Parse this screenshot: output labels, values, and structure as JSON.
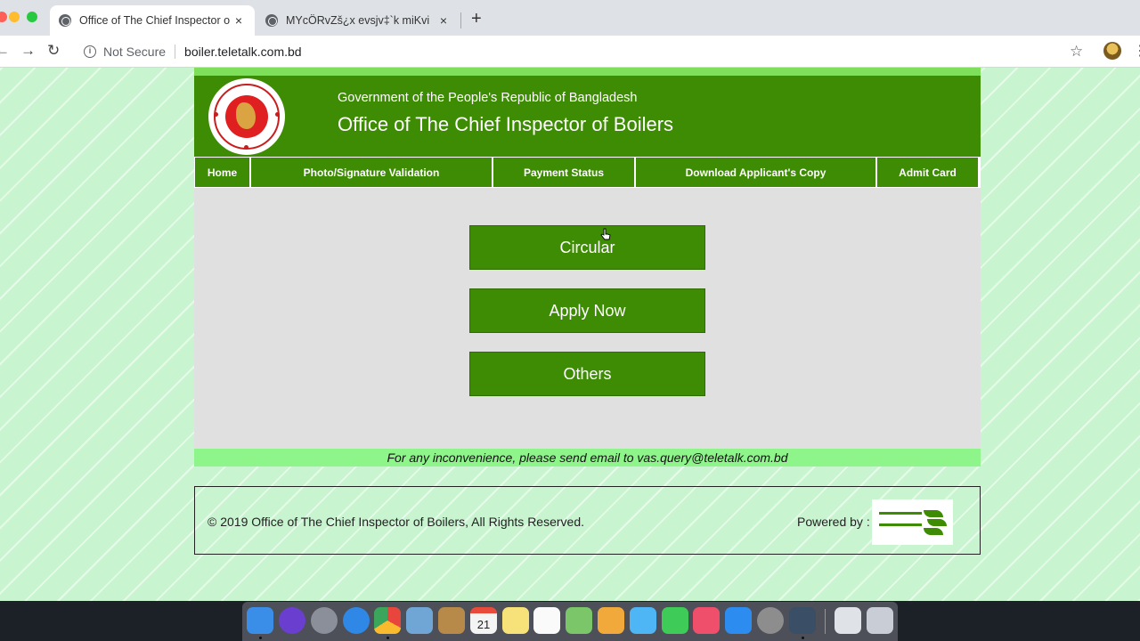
{
  "browser": {
    "tabs": [
      {
        "title": "Office of The Chief Inspector o",
        "active": true
      },
      {
        "title": "MYcÖRvZš¿x evsjv‡`k miKvi",
        "active": false
      }
    ],
    "close_symbol": "×",
    "new_tab_symbol": "+",
    "security_label": "Not Secure",
    "url": "boiler.teletalk.com.bd",
    "icons": {
      "back": "←",
      "forward": "→",
      "reload": "↻",
      "info": "i",
      "star": "☆",
      "menu": "⋮"
    }
  },
  "site": {
    "header": {
      "government": "Government of the People's Republic of Bangladesh",
      "office": "Office of The Chief Inspector of Boilers"
    },
    "nav": [
      {
        "label": "Home"
      },
      {
        "label": "Photo/Signature Validation"
      },
      {
        "label": "Payment Status"
      },
      {
        "label": "Download Applicant's Copy"
      },
      {
        "label": "Admit Card"
      }
    ],
    "actions": [
      {
        "label": "Circular"
      },
      {
        "label": "Apply Now"
      },
      {
        "label": "Others"
      }
    ],
    "notice": "For any inconvenience, please send email to vas.query@teletalk.com.bd",
    "footer": {
      "copyright": "© 2019 Office of The Chief Inspector of Boilers, All Rights Reserved.",
      "powered_by": "Powered by :"
    },
    "colors": {
      "primary_green": "#3d8c03",
      "light_green": "#8ef58a",
      "background": "#c8f5d0"
    }
  },
  "dock": {
    "apps": [
      {
        "name": "Finder",
        "color": "#3b8ee8"
      },
      {
        "name": "Siri",
        "color": "#6a3fd0"
      },
      {
        "name": "Launchpad",
        "color": "#8a8f99"
      },
      {
        "name": "Safari",
        "color": "#2f87e6"
      },
      {
        "name": "Chrome",
        "color": "#e8453c"
      },
      {
        "name": "Preview",
        "color": "#6fa6d6"
      },
      {
        "name": "Contacts",
        "color": "#b88a4a"
      },
      {
        "name": "Calendar",
        "color": "#f4f4f4"
      },
      {
        "name": "Notes",
        "color": "#f7e27a"
      },
      {
        "name": "Reminders",
        "color": "#fafafa"
      },
      {
        "name": "Maps",
        "color": "#7cc66a"
      },
      {
        "name": "Photos",
        "color": "#f2a93b"
      },
      {
        "name": "Messages",
        "color": "#4fb6f5"
      },
      {
        "name": "FaceTime",
        "color": "#3ecb58"
      },
      {
        "name": "Music",
        "color": "#f04f6c"
      },
      {
        "name": "App Store",
        "color": "#2d8cf0"
      },
      {
        "name": "System Preferences",
        "color": "#8d8d8d"
      },
      {
        "name": "QuickTime",
        "color": "#3a4e66"
      },
      {
        "name": "Downloads",
        "color": "#dfe3e8"
      },
      {
        "name": "Trash",
        "color": "#c9ced6"
      }
    ],
    "calendar_day": "21"
  }
}
